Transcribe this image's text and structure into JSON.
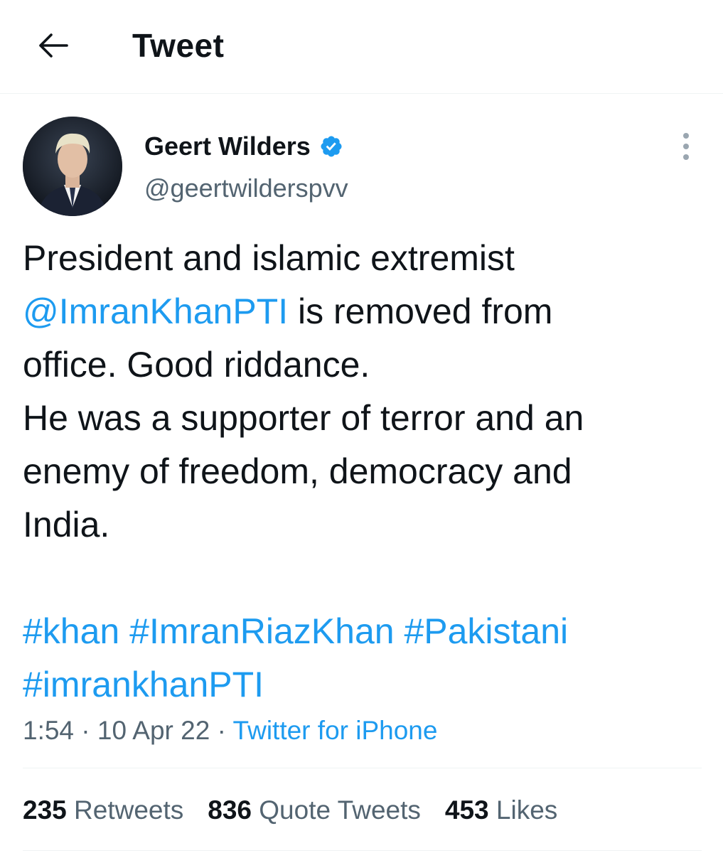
{
  "header": {
    "title": "Tweet",
    "back_icon": "arrow-left-icon"
  },
  "author": {
    "name": "Geert Wilders",
    "handle": "@geertwilderspvv",
    "verified_icon": "verified-badge-icon",
    "verified_color": "#1d9bf0"
  },
  "tweet": {
    "lines": [
      [
        {
          "text": "President and islamic extremist",
          "link": false
        }
      ],
      [
        {
          "text": "@ImranKhanPTI",
          "link": true
        },
        {
          "text": " is removed from",
          "link": false
        }
      ],
      [
        {
          "text": "office. Good riddance.",
          "link": false
        }
      ],
      [
        {
          "text": "He was a supporter of terror and an",
          "link": false
        }
      ],
      [
        {
          "text": "enemy of freedom, democracy and",
          "link": false
        }
      ],
      [
        {
          "text": "India.",
          "link": false
        }
      ],
      [],
      [
        {
          "text": "#khan",
          "link": true
        },
        {
          "text": " ",
          "link": false
        },
        {
          "text": "#ImranRiazKhan",
          "link": true
        },
        {
          "text": " ",
          "link": false
        },
        {
          "text": "#Pakistani",
          "link": true
        }
      ],
      [
        {
          "text": "#imrankhanPTI",
          "link": true
        }
      ]
    ],
    "time": "1:54",
    "separator": "·",
    "date": "10 Apr 22",
    "source": "Twitter for iPhone"
  },
  "stats": [
    {
      "count": "235",
      "label": "Retweets"
    },
    {
      "count": "836",
      "label": "Quote Tweets"
    },
    {
      "count": "453",
      "label": "Likes"
    }
  ],
  "colors": {
    "link": "#1d9bf0",
    "text": "#0f1419",
    "secondary": "#536471"
  }
}
